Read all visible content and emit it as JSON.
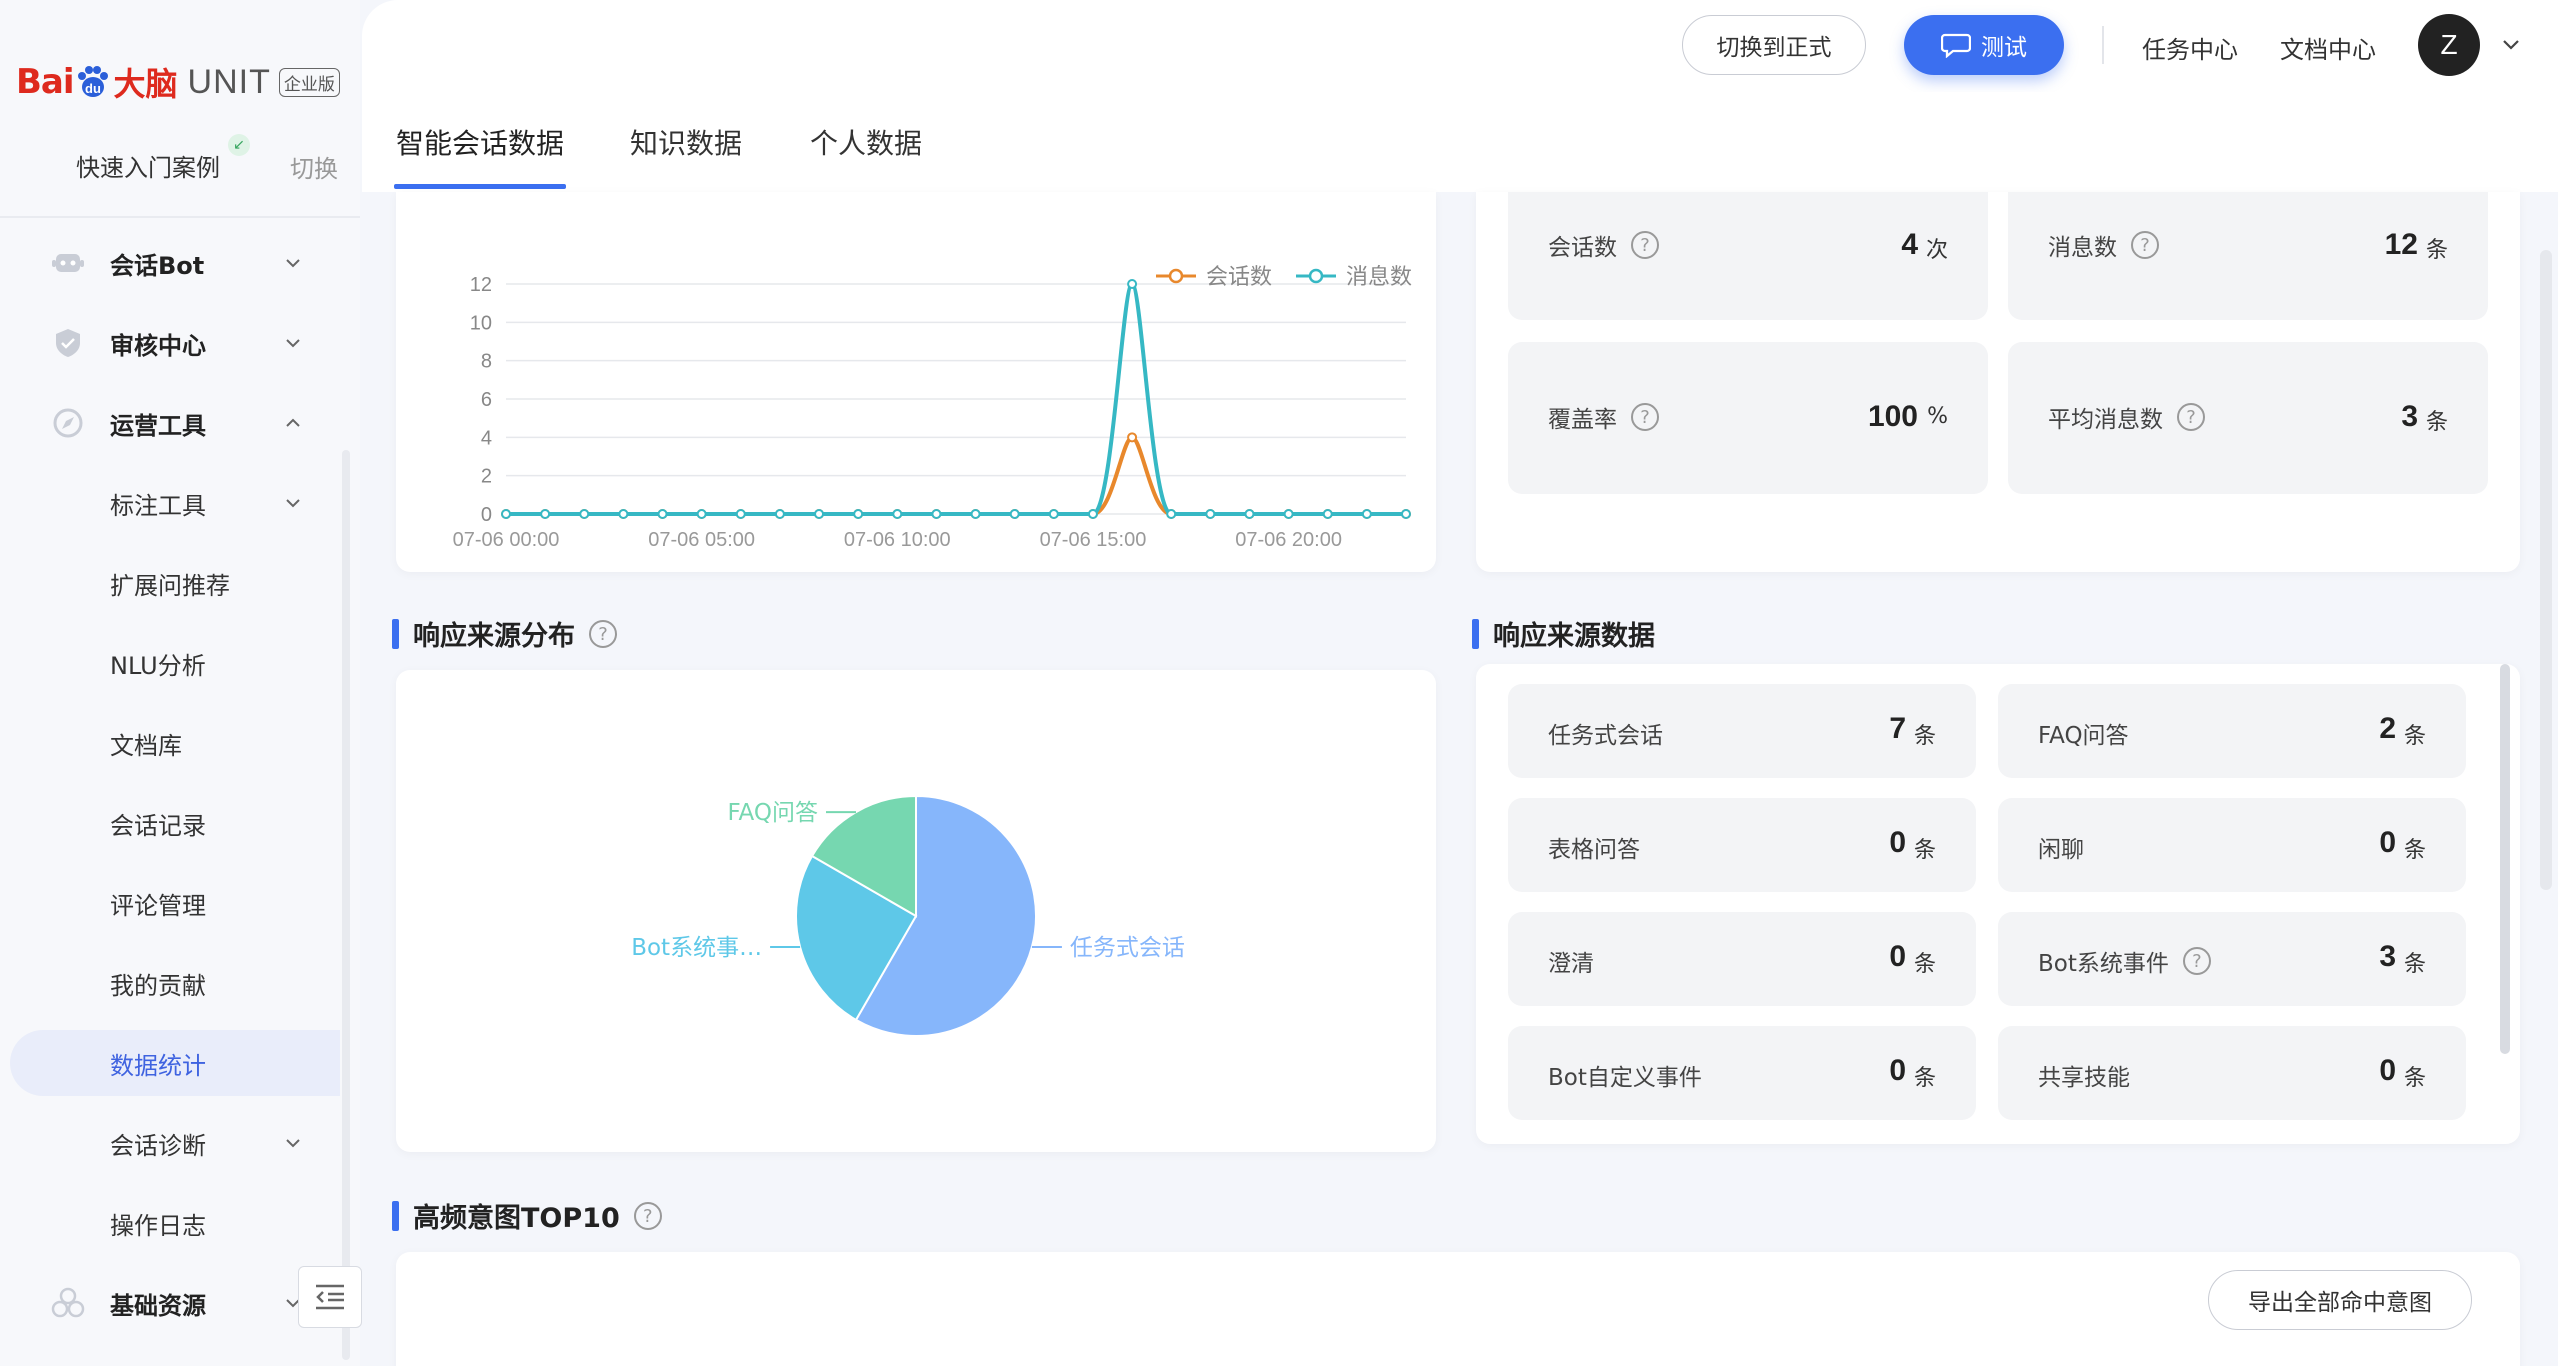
{
  "brand": {
    "bai": "Bai",
    "du": "du",
    "danao": "大脑",
    "unit": "UNIT",
    "edition": "企业版"
  },
  "sidebar": {
    "quick_start": "快速入门案例",
    "switch": "切换",
    "items": [
      {
        "label": "会话Bot",
        "icon": "bot-icon",
        "chevron": "down"
      },
      {
        "label": "审核中心",
        "icon": "shield-icon",
        "chevron": "down"
      },
      {
        "label": "运营工具",
        "icon": "compass-icon",
        "chevron": "up"
      },
      {
        "label": "标注工具",
        "chevron": "down"
      },
      {
        "label": "扩展问推荐"
      },
      {
        "label": "NLU分析"
      },
      {
        "label": "文档库"
      },
      {
        "label": "会话记录"
      },
      {
        "label": "评论管理"
      },
      {
        "label": "我的贡献"
      },
      {
        "label": "数据统计",
        "active": true
      },
      {
        "label": "会话诊断",
        "chevron": "down"
      },
      {
        "label": "操作日志"
      },
      {
        "label": "基础资源",
        "icon": "cubes-icon",
        "chevron": "down"
      }
    ]
  },
  "header": {
    "switch_formal": "切换到正式",
    "test": "测试",
    "task_center": "任务中心",
    "doc_center": "文档中心",
    "avatar_initial": "Z"
  },
  "tabs": [
    "智能会话数据",
    "知识数据",
    "个人数据"
  ],
  "chart_data": [
    {
      "type": "line",
      "series": [
        {
          "name": "会话数",
          "color": "#e8882c",
          "peak_x": "07-06 16:00",
          "peak_value": 4
        },
        {
          "name": "消息数",
          "color": "#36b8c4",
          "peak_x": "07-06 16:00",
          "peak_value": 12
        }
      ],
      "x_ticks": [
        "07-06 00:00",
        "07-06 05:00",
        "07-06 10:00",
        "07-06 15:00",
        "07-06 20:00"
      ],
      "y_ticks": [
        "12",
        "10",
        "8",
        "6",
        "4",
        "2",
        "0"
      ],
      "ylim": [
        0,
        12
      ],
      "points_per_series": 24,
      "legend": "top-right",
      "grid": true
    },
    {
      "type": "pie",
      "slices": [
        {
          "label": "任务式会话",
          "value": 7,
          "color": "#86b6fb"
        },
        {
          "label": "Bot系统事…",
          "value": 3,
          "color": "#5ec8e8"
        },
        {
          "label": "FAQ问答",
          "value": 2,
          "color": "#76d7b0"
        }
      ]
    }
  ],
  "overview": {
    "sessions": {
      "label": "会话数",
      "value": "4",
      "unit": "次"
    },
    "messages": {
      "label": "消息数",
      "value": "12",
      "unit": "条"
    },
    "coverage": {
      "label": "覆盖率",
      "value": "100",
      "unit": "%"
    },
    "avg_messages": {
      "label": "平均消息数",
      "value": "3",
      "unit": "条"
    }
  },
  "response_dist": {
    "title": "响应来源分布"
  },
  "response_data": {
    "title": "响应来源数据",
    "items": [
      {
        "label": "任务式会话",
        "value": "7",
        "unit": "条"
      },
      {
        "label": "FAQ问答",
        "value": "2",
        "unit": "条"
      },
      {
        "label": "表格问答",
        "value": "0",
        "unit": "条"
      },
      {
        "label": "闲聊",
        "value": "0",
        "unit": "条"
      },
      {
        "label": "澄清",
        "value": "0",
        "unit": "条"
      },
      {
        "label": "Bot系统事件",
        "value": "3",
        "unit": "条",
        "help": true
      },
      {
        "label": "Bot自定义事件",
        "value": "0",
        "unit": "条"
      },
      {
        "label": "共享技能",
        "value": "0",
        "unit": "条"
      }
    ]
  },
  "top_intents": {
    "title": "高频意图TOP10",
    "export": "导出全部命中意图"
  }
}
